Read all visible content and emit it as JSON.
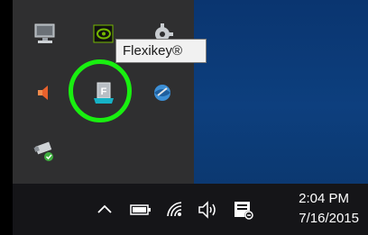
{
  "tooltip": {
    "text": "Flexikey®"
  },
  "clock": {
    "time": "2:04 PM",
    "date": "7/16/2015"
  },
  "tray_icons": [
    "display-icon",
    "nvidia-icon",
    "settings-icon",
    "speaker-icon",
    "flexikey-icon",
    "network-globe-icon",
    "usb-drive-icon"
  ],
  "taskbar_icons": [
    "chevron-up-icon",
    "battery-icon",
    "wifi-icon",
    "volume-icon",
    "action-center-icon"
  ],
  "colors": {
    "highlight_ring": "#19ef10",
    "flyout_bg": "#2f2f30",
    "taskbar_bg": "#151518",
    "desktop_bg": "#0d3a74"
  }
}
